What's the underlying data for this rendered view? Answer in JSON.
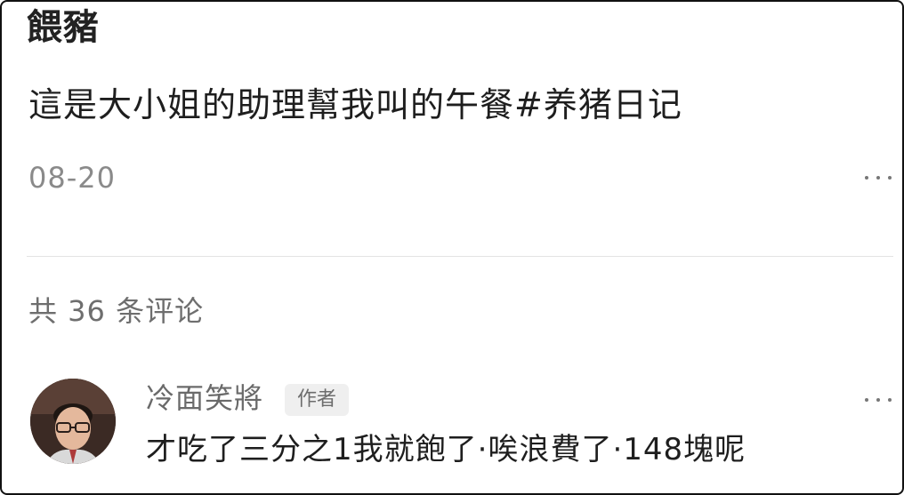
{
  "post": {
    "title": "餵豬",
    "text": "這是大小姐的助理幫我叫的午餐#养猪日记",
    "date": "08-20"
  },
  "comments_section": {
    "count_label": "共 36 条评论",
    "comments": [
      {
        "username": "冷面笑將",
        "badge": "作者",
        "text": "才吃了三分之1我就飽了·唉浪費了·148塊呢"
      }
    ]
  },
  "icons": {
    "more": "more-horizontal-icon",
    "avatar": "user-avatar"
  }
}
